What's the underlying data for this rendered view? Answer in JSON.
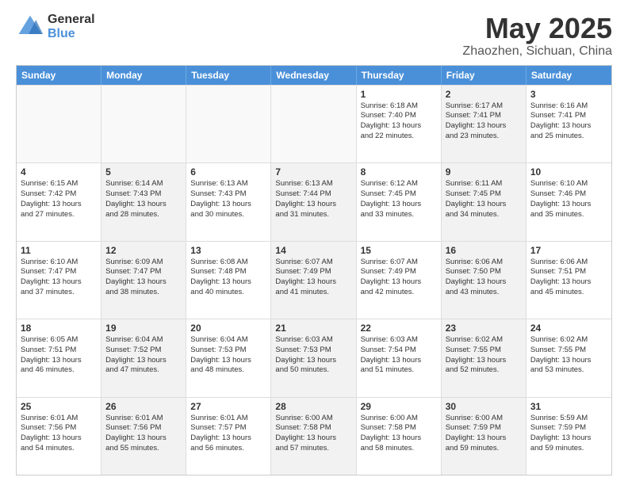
{
  "logo": {
    "general": "General",
    "blue": "Blue"
  },
  "title": {
    "month": "May 2025",
    "location": "Zhaozhen, Sichuan, China"
  },
  "weekdays": [
    "Sunday",
    "Monday",
    "Tuesday",
    "Wednesday",
    "Thursday",
    "Friday",
    "Saturday"
  ],
  "rows": [
    [
      {
        "day": "",
        "lines": [],
        "empty": true
      },
      {
        "day": "",
        "lines": [],
        "empty": true
      },
      {
        "day": "",
        "lines": [],
        "empty": true
      },
      {
        "day": "",
        "lines": [],
        "empty": true
      },
      {
        "day": "1",
        "lines": [
          "Sunrise: 6:18 AM",
          "Sunset: 7:40 PM",
          "Daylight: 13 hours",
          "and 22 minutes."
        ],
        "shaded": false
      },
      {
        "day": "2",
        "lines": [
          "Sunrise: 6:17 AM",
          "Sunset: 7:41 PM",
          "Daylight: 13 hours",
          "and 23 minutes."
        ],
        "shaded": true
      },
      {
        "day": "3",
        "lines": [
          "Sunrise: 6:16 AM",
          "Sunset: 7:41 PM",
          "Daylight: 13 hours",
          "and 25 minutes."
        ],
        "shaded": false
      }
    ],
    [
      {
        "day": "4",
        "lines": [
          "Sunrise: 6:15 AM",
          "Sunset: 7:42 PM",
          "Daylight: 13 hours",
          "and 27 minutes."
        ],
        "shaded": false
      },
      {
        "day": "5",
        "lines": [
          "Sunrise: 6:14 AM",
          "Sunset: 7:43 PM",
          "Daylight: 13 hours",
          "and 28 minutes."
        ],
        "shaded": true
      },
      {
        "day": "6",
        "lines": [
          "Sunrise: 6:13 AM",
          "Sunset: 7:43 PM",
          "Daylight: 13 hours",
          "and 30 minutes."
        ],
        "shaded": false
      },
      {
        "day": "7",
        "lines": [
          "Sunrise: 6:13 AM",
          "Sunset: 7:44 PM",
          "Daylight: 13 hours",
          "and 31 minutes."
        ],
        "shaded": true
      },
      {
        "day": "8",
        "lines": [
          "Sunrise: 6:12 AM",
          "Sunset: 7:45 PM",
          "Daylight: 13 hours",
          "and 33 minutes."
        ],
        "shaded": false
      },
      {
        "day": "9",
        "lines": [
          "Sunrise: 6:11 AM",
          "Sunset: 7:45 PM",
          "Daylight: 13 hours",
          "and 34 minutes."
        ],
        "shaded": true
      },
      {
        "day": "10",
        "lines": [
          "Sunrise: 6:10 AM",
          "Sunset: 7:46 PM",
          "Daylight: 13 hours",
          "and 35 minutes."
        ],
        "shaded": false
      }
    ],
    [
      {
        "day": "11",
        "lines": [
          "Sunrise: 6:10 AM",
          "Sunset: 7:47 PM",
          "Daylight: 13 hours",
          "and 37 minutes."
        ],
        "shaded": false
      },
      {
        "day": "12",
        "lines": [
          "Sunrise: 6:09 AM",
          "Sunset: 7:47 PM",
          "Daylight: 13 hours",
          "and 38 minutes."
        ],
        "shaded": true
      },
      {
        "day": "13",
        "lines": [
          "Sunrise: 6:08 AM",
          "Sunset: 7:48 PM",
          "Daylight: 13 hours",
          "and 40 minutes."
        ],
        "shaded": false
      },
      {
        "day": "14",
        "lines": [
          "Sunrise: 6:07 AM",
          "Sunset: 7:49 PM",
          "Daylight: 13 hours",
          "and 41 minutes."
        ],
        "shaded": true
      },
      {
        "day": "15",
        "lines": [
          "Sunrise: 6:07 AM",
          "Sunset: 7:49 PM",
          "Daylight: 13 hours",
          "and 42 minutes."
        ],
        "shaded": false
      },
      {
        "day": "16",
        "lines": [
          "Sunrise: 6:06 AM",
          "Sunset: 7:50 PM",
          "Daylight: 13 hours",
          "and 43 minutes."
        ],
        "shaded": true
      },
      {
        "day": "17",
        "lines": [
          "Sunrise: 6:06 AM",
          "Sunset: 7:51 PM",
          "Daylight: 13 hours",
          "and 45 minutes."
        ],
        "shaded": false
      }
    ],
    [
      {
        "day": "18",
        "lines": [
          "Sunrise: 6:05 AM",
          "Sunset: 7:51 PM",
          "Daylight: 13 hours",
          "and 46 minutes."
        ],
        "shaded": false
      },
      {
        "day": "19",
        "lines": [
          "Sunrise: 6:04 AM",
          "Sunset: 7:52 PM",
          "Daylight: 13 hours",
          "and 47 minutes."
        ],
        "shaded": true
      },
      {
        "day": "20",
        "lines": [
          "Sunrise: 6:04 AM",
          "Sunset: 7:53 PM",
          "Daylight: 13 hours",
          "and 48 minutes."
        ],
        "shaded": false
      },
      {
        "day": "21",
        "lines": [
          "Sunrise: 6:03 AM",
          "Sunset: 7:53 PM",
          "Daylight: 13 hours",
          "and 50 minutes."
        ],
        "shaded": true
      },
      {
        "day": "22",
        "lines": [
          "Sunrise: 6:03 AM",
          "Sunset: 7:54 PM",
          "Daylight: 13 hours",
          "and 51 minutes."
        ],
        "shaded": false
      },
      {
        "day": "23",
        "lines": [
          "Sunrise: 6:02 AM",
          "Sunset: 7:55 PM",
          "Daylight: 13 hours",
          "and 52 minutes."
        ],
        "shaded": true
      },
      {
        "day": "24",
        "lines": [
          "Sunrise: 6:02 AM",
          "Sunset: 7:55 PM",
          "Daylight: 13 hours",
          "and 53 minutes."
        ],
        "shaded": false
      }
    ],
    [
      {
        "day": "25",
        "lines": [
          "Sunrise: 6:01 AM",
          "Sunset: 7:56 PM",
          "Daylight: 13 hours",
          "and 54 minutes."
        ],
        "shaded": false
      },
      {
        "day": "26",
        "lines": [
          "Sunrise: 6:01 AM",
          "Sunset: 7:56 PM",
          "Daylight: 13 hours",
          "and 55 minutes."
        ],
        "shaded": true
      },
      {
        "day": "27",
        "lines": [
          "Sunrise: 6:01 AM",
          "Sunset: 7:57 PM",
          "Daylight: 13 hours",
          "and 56 minutes."
        ],
        "shaded": false
      },
      {
        "day": "28",
        "lines": [
          "Sunrise: 6:00 AM",
          "Sunset: 7:58 PM",
          "Daylight: 13 hours",
          "and 57 minutes."
        ],
        "shaded": true
      },
      {
        "day": "29",
        "lines": [
          "Sunrise: 6:00 AM",
          "Sunset: 7:58 PM",
          "Daylight: 13 hours",
          "and 58 minutes."
        ],
        "shaded": false
      },
      {
        "day": "30",
        "lines": [
          "Sunrise: 6:00 AM",
          "Sunset: 7:59 PM",
          "Daylight: 13 hours",
          "and 59 minutes."
        ],
        "shaded": true
      },
      {
        "day": "31",
        "lines": [
          "Sunrise: 5:59 AM",
          "Sunset: 7:59 PM",
          "Daylight: 13 hours",
          "and 59 minutes."
        ],
        "shaded": false
      }
    ]
  ]
}
